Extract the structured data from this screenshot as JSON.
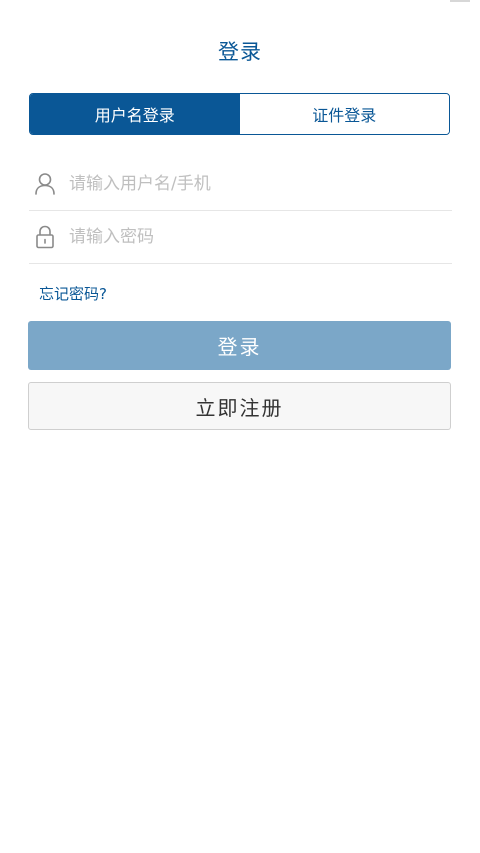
{
  "header": {
    "title": "登录"
  },
  "tabs": [
    {
      "label": "用户名登录",
      "active": true
    },
    {
      "label": "证件登录",
      "active": false
    }
  ],
  "form": {
    "username": {
      "placeholder": "请输入用户名/手机",
      "value": "",
      "icon": "user-icon"
    },
    "password": {
      "placeholder": "请输入密码",
      "value": "",
      "icon": "lock-icon"
    },
    "forgot_label": "忘记密码?"
  },
  "buttons": {
    "login_label": "登录",
    "register_label": "立即注册"
  },
  "colors": {
    "primary": "#0a5796",
    "login_button": "#7ba7c8",
    "placeholder": "#bfbfbf"
  }
}
